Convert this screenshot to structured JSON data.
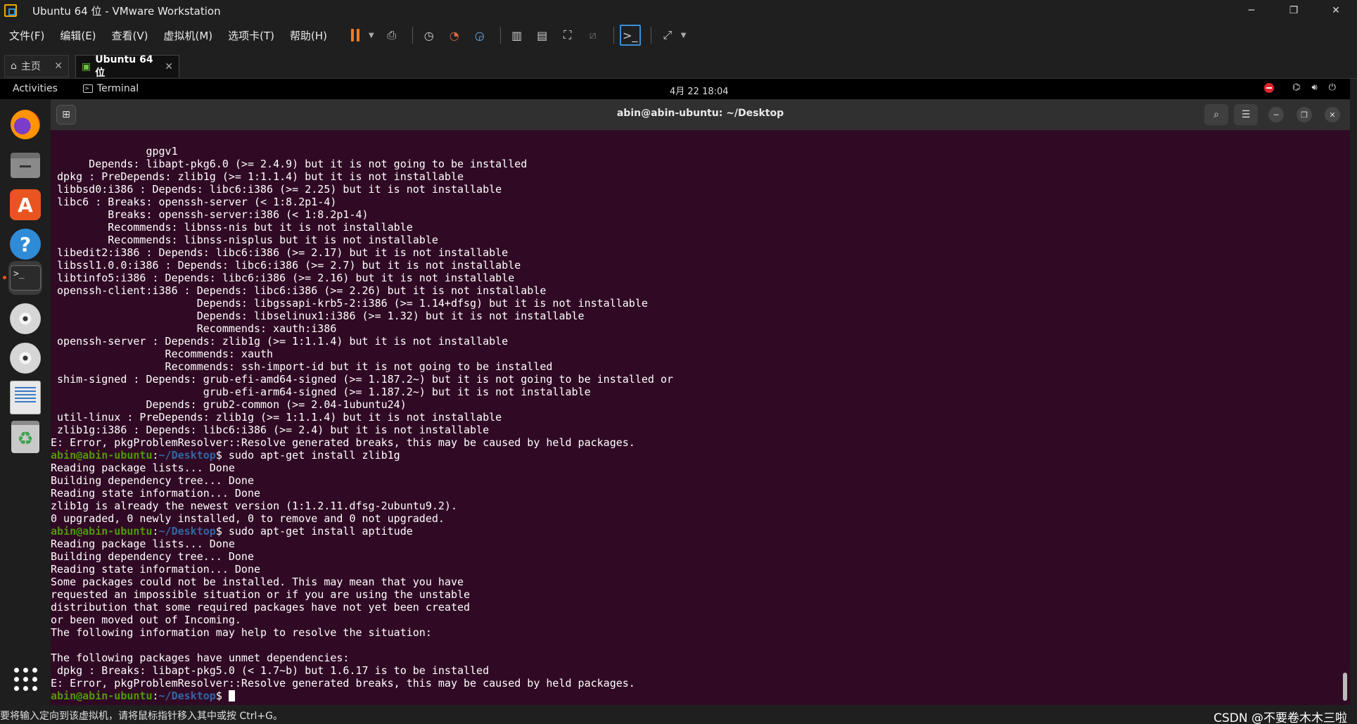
{
  "window": {
    "title": "Ubuntu 64 位 - VMware Workstation",
    "minimize": "─",
    "restore": "❐",
    "close": "✕"
  },
  "menu": [
    "文件(F)",
    "编辑(E)",
    "查看(V)",
    "虚拟机(M)",
    "选项卡(T)",
    "帮助(H)"
  ],
  "tabs": {
    "home": "主页",
    "vm": "Ubuntu 64 位"
  },
  "gnome": {
    "activities": "Activities",
    "app": "Terminal",
    "clock": "4月 22  18:04"
  },
  "terminal": {
    "title": "abin@abin-ubuntu: ~/Desktop",
    "prompt_user": "abin@abin-ubuntu",
    "prompt_sep": ":",
    "prompt_path": "~/Desktop",
    "prompt_end": "$ ",
    "lines": [
      {
        "t": "out",
        "text": "               gpgv1"
      },
      {
        "t": "out",
        "text": "      Depends: libapt-pkg6.0 (>= 2.4.9) but it is not going to be installed"
      },
      {
        "t": "out",
        "text": " dpkg : PreDepends: zlib1g (>= 1:1.1.4) but it is not installable"
      },
      {
        "t": "out",
        "text": " libbsd0:i386 : Depends: libc6:i386 (>= 2.25) but it is not installable"
      },
      {
        "t": "out",
        "text": " libc6 : Breaks: openssh-server (< 1:8.2p1-4)"
      },
      {
        "t": "out",
        "text": "         Breaks: openssh-server:i386 (< 1:8.2p1-4)"
      },
      {
        "t": "out",
        "text": "         Recommends: libnss-nis but it is not installable"
      },
      {
        "t": "out",
        "text": "         Recommends: libnss-nisplus but it is not installable"
      },
      {
        "t": "out",
        "text": " libedit2:i386 : Depends: libc6:i386 (>= 2.17) but it is not installable"
      },
      {
        "t": "out",
        "text": " libssl1.0.0:i386 : Depends: libc6:i386 (>= 2.7) but it is not installable"
      },
      {
        "t": "out",
        "text": " libtinfo5:i386 : Depends: libc6:i386 (>= 2.16) but it is not installable"
      },
      {
        "t": "out",
        "text": " openssh-client:i386 : Depends: libc6:i386 (>= 2.26) but it is not installable"
      },
      {
        "t": "out",
        "text": "                       Depends: libgssapi-krb5-2:i386 (>= 1.14+dfsg) but it is not installable"
      },
      {
        "t": "out",
        "text": "                       Depends: libselinux1:i386 (>= 1.32) but it is not installable"
      },
      {
        "t": "out",
        "text": "                       Recommends: xauth:i386"
      },
      {
        "t": "out",
        "text": " openssh-server : Depends: zlib1g (>= 1:1.1.4) but it is not installable"
      },
      {
        "t": "out",
        "text": "                  Recommends: xauth"
      },
      {
        "t": "out",
        "text": "                  Recommends: ssh-import-id but it is not going to be installed"
      },
      {
        "t": "out",
        "text": " shim-signed : Depends: grub-efi-amd64-signed (>= 1.187.2~) but it is not going to be installed or"
      },
      {
        "t": "out",
        "text": "                        grub-efi-arm64-signed (>= 1.187.2~) but it is not installable"
      },
      {
        "t": "out",
        "text": "               Depends: grub2-common (>= 2.04-1ubuntu24)"
      },
      {
        "t": "out",
        "text": " util-linux : PreDepends: zlib1g (>= 1:1.1.4) but it is not installable"
      },
      {
        "t": "out",
        "text": " zlib1g:i386 : Depends: libc6:i386 (>= 2.4) but it is not installable"
      },
      {
        "t": "out",
        "text": "E: Error, pkgProblemResolver::Resolve generated breaks, this may be caused by held packages."
      },
      {
        "t": "cmd",
        "text": "sudo apt-get install zlib1g"
      },
      {
        "t": "out",
        "text": "Reading package lists... Done"
      },
      {
        "t": "out",
        "text": "Building dependency tree... Done"
      },
      {
        "t": "out",
        "text": "Reading state information... Done"
      },
      {
        "t": "out",
        "text": "zlib1g is already the newest version (1:1.2.11.dfsg-2ubuntu9.2)."
      },
      {
        "t": "out",
        "text": "0 upgraded, 0 newly installed, 0 to remove and 0 not upgraded."
      },
      {
        "t": "cmd",
        "text": "sudo apt-get install aptitude"
      },
      {
        "t": "out",
        "text": "Reading package lists... Done"
      },
      {
        "t": "out",
        "text": "Building dependency tree... Done"
      },
      {
        "t": "out",
        "text": "Reading state information... Done"
      },
      {
        "t": "out",
        "text": "Some packages could not be installed. This may mean that you have"
      },
      {
        "t": "out",
        "text": "requested an impossible situation or if you are using the unstable"
      },
      {
        "t": "out",
        "text": "distribution that some required packages have not yet been created"
      },
      {
        "t": "out",
        "text": "or been moved out of Incoming."
      },
      {
        "t": "out",
        "text": "The following information may help to resolve the situation:"
      },
      {
        "t": "out",
        "text": ""
      },
      {
        "t": "out",
        "text": "The following packages have unmet dependencies:"
      },
      {
        "t": "out",
        "text": " dpkg : Breaks: libapt-pkg5.0 (< 1.7~b) but 1.6.17 is to be installed"
      },
      {
        "t": "out",
        "text": "E: Error, pkgProblemResolver::Resolve generated breaks, this may be caused by held packages."
      },
      {
        "t": "cmd",
        "text": ""
      }
    ]
  },
  "status": {
    "message": "要将输入定向到该虚拟机，请将鼠标指针移入其中或按 Ctrl+G。",
    "watermark": "CSDN @不要卷木木三啦"
  },
  "colors": {
    "terminal_bg": "#300a24",
    "prompt_user": "#4e9a06",
    "prompt_path": "#3465a4",
    "ubuntu_orange": "#e95420",
    "pause": "#f57b20"
  }
}
